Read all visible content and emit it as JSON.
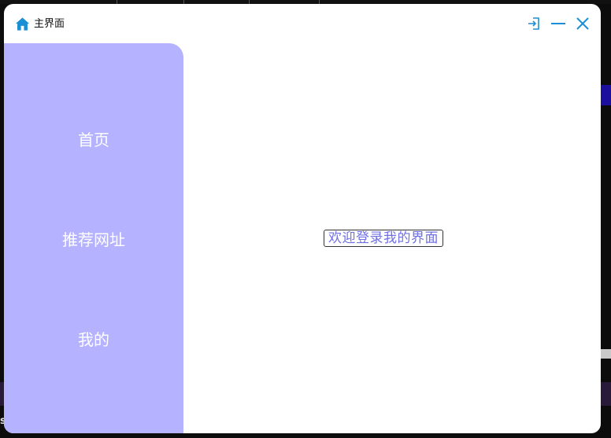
{
  "window": {
    "title": "主界面",
    "controls": {
      "exit_icon": "exit-icon",
      "minimize_icon": "minimize-icon",
      "close_icon": "close-icon"
    },
    "accent_color": "#1a8fd6"
  },
  "sidebar": {
    "background": "#b5b2ff",
    "items": [
      {
        "label": "首页"
      },
      {
        "label": "推荐网址"
      },
      {
        "label": "我的"
      }
    ]
  },
  "main": {
    "welcome_text": "欢迎登录我的界面",
    "welcome_color": "#6f6fe6"
  },
  "desktop": {
    "bottom_fragment": "s"
  }
}
